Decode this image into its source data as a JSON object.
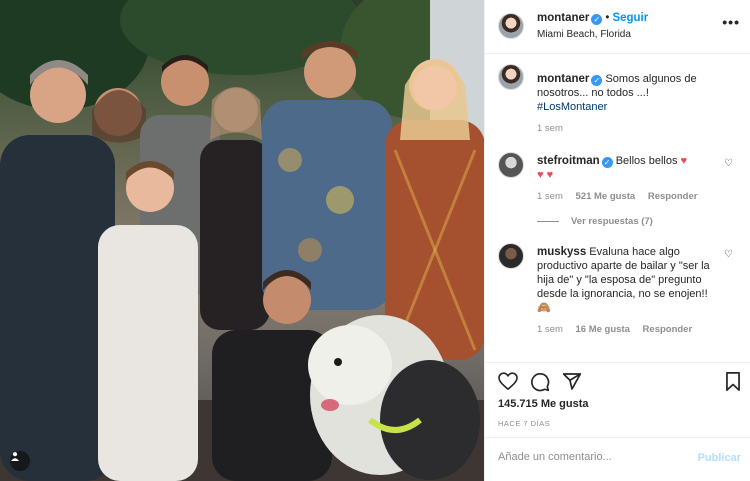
{
  "photo": {
    "alt": "",
    "tag_icon": "person-tag-icon"
  },
  "header": {
    "username": "montaner",
    "verified_icon": "verified-badge-icon",
    "separator": "•",
    "follow_label": "Seguir",
    "location": "Miami Beach, Florida",
    "more_icon": "more-options-icon",
    "more_label": "•••"
  },
  "caption": {
    "username": "montaner",
    "text": "Somos algunos de nosotros... no todos ...! ",
    "hashtag": "#LosMontaner",
    "time": "1 sem"
  },
  "comments": [
    {
      "username": "stefroitman",
      "text": "Bellos bellos",
      "emoji_line": "♥ ♥",
      "time": "1 sem",
      "likes": "521 Me gusta",
      "reply": "Responder",
      "view_replies": "Ver respuestas (7)"
    },
    {
      "username": "muskyss",
      "text": "Evaluna hace algo productivo aparte de bailar y \"ser la hija de\" y \"la esposa de\" pregunto desde la ignorancia, no se enojen!! 🙈",
      "time": "1 sem",
      "likes": "16 Me gusta",
      "reply": "Responder"
    }
  ],
  "actions": {
    "like_icon": "heart-icon",
    "comment_icon": "comment-icon",
    "share_icon": "share-icon",
    "save_icon": "bookmark-icon"
  },
  "likes_count": "145.715 Me gusta",
  "posted_ago": "HACE 7 DÍAS",
  "comment_box": {
    "placeholder": "Añade un comentario...",
    "publish_label": "Publicar"
  },
  "colors": {
    "accent": "#0095f6",
    "verified": "#3897f0",
    "heart": "#ed4956",
    "muted": "#8e8e8e"
  }
}
